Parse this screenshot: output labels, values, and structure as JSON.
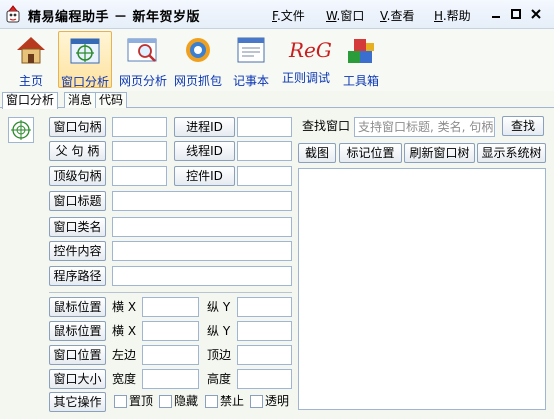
{
  "window": {
    "title": "精易编程助手 － 新年贺岁版",
    "menus": [
      {
        "key": "F",
        "label": ".文件"
      },
      {
        "key": "W",
        "label": ".窗口"
      },
      {
        "key": "V",
        "label": ".查看"
      },
      {
        "key": "H",
        "label": ".帮助"
      }
    ]
  },
  "toolbar": {
    "items": [
      {
        "label": "主页",
        "icon": "home-icon"
      },
      {
        "label": "窗口分析",
        "icon": "window-target-icon",
        "active": true
      },
      {
        "label": "网页分析",
        "icon": "webpage-search-icon"
      },
      {
        "label": "网页抓包",
        "icon": "packet-capture-icon"
      },
      {
        "label": "记事本",
        "icon": "notepad-icon"
      },
      {
        "label": "正则调试",
        "icon": "regex-icon"
      },
      {
        "label": "工具箱",
        "icon": "toolbox-icon"
      }
    ],
    "regex_logo_text": "ReG"
  },
  "tabs": [
    "窗口分析",
    "消息",
    "代码"
  ],
  "left": {
    "buttons": {
      "window_handle": "窗口句柄",
      "parent_handle": "父 句 柄",
      "top_handle": "顶级句柄",
      "window_title": "窗口标题",
      "window_class": "窗口类名",
      "control_content": "控件内容",
      "program_path": "程序路径",
      "process_id": "进程ID",
      "thread_id": "线程ID",
      "control_id": "控件ID",
      "mouse_pos_1": "鼠标位置",
      "mouse_pos_2": "鼠标位置",
      "window_pos": "窗口位置",
      "window_size": "窗口大小",
      "other_ops": "其它操作"
    },
    "labels": {
      "horiz_x": "横 X",
      "vert_y": "纵 Y",
      "left_edge": "左边",
      "top_edge": "顶边",
      "width": "宽度",
      "height": "高度"
    },
    "checkboxes": [
      "置顶",
      "隐藏",
      "禁止",
      "透明"
    ]
  },
  "right": {
    "find_window_label": "查找窗口",
    "search_placeholder": "支持窗口标题, 类名, 句柄",
    "find_button": "查找",
    "actions": [
      "截图",
      "标记位置",
      "刷新窗口树",
      "显示系统树"
    ]
  },
  "colors": {
    "toolbar_label": "#0b35b5",
    "active_tab_bg": "#ffe3a0",
    "border": "#9fb5d2"
  }
}
